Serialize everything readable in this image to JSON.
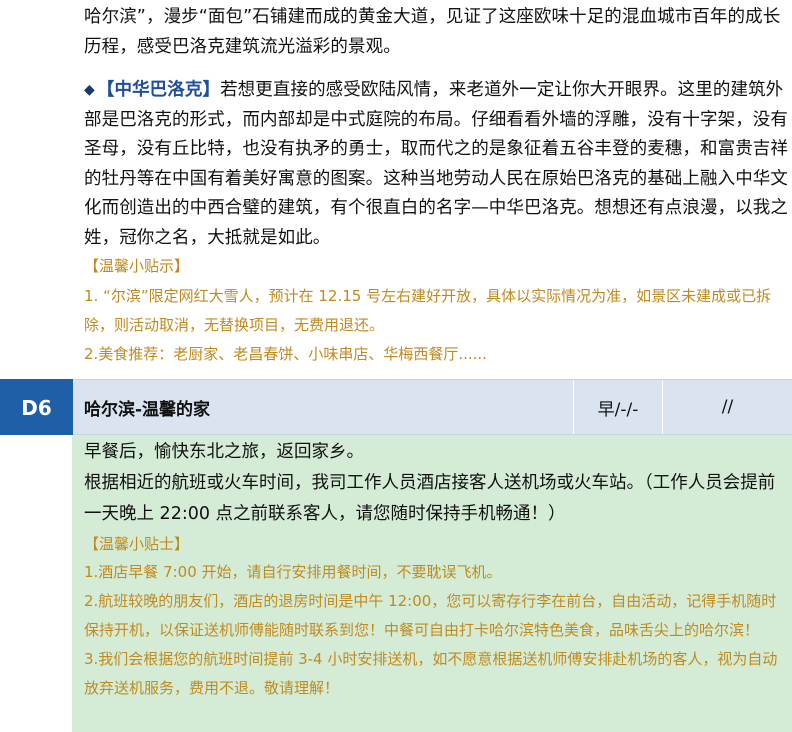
{
  "intro": {
    "text": "哈尔滨”，漫步“面包”石铺建而成的黄金大道，见证了这座欧味十足的混血城市百年的成长历程，感受巴洛克建筑流光溢彩的景观。"
  },
  "highlight": {
    "bullet": "◆",
    "title": "【中华巴洛克】",
    "text": "若想更直接的感受欧陆风情，来老道外一定让你大开眼界。这里的建筑外部是巴洛克的形式，而内部却是中式庭院的布局。仔细看看外墙的浮雕，没有十字架，没有圣母，没有丘比特，也没有执矛的勇士，取而代之的是象征着五谷丰登的麦穗，和富贵吉祥的牡丹等在中国有着美好寓意的图案。这种当地劳动人民在原始巴洛克的基础上融入中华文化而创造出的中西合璧的建筑，有个很直白的名字—中华巴洛克。想想还有点浪漫，以我之姓，冠你之名，大抵就是如此。"
  },
  "tips_top": {
    "title": "【温馨小贴示】",
    "items": [
      "1. “尔滨”限定网红大雪人，预计在 12.15 号左右建好开放，具体以实际情况为准，如景区未建成或已拆除，则活动取消，无替换项目，无费用退还。",
      "2.美食推荐：老厨家、老昌春饼、小味串店、华梅西餐厅......"
    ]
  },
  "day": {
    "badge": "D6",
    "title": "哈尔滨-温馨的家",
    "meals": "早/-/-",
    "hotel": "//"
  },
  "day_body": {
    "lines": [
      "早餐后，愉快东北之旅，返回家乡。",
      "根据相近的航班或火车时间，我司工作人员酒店接客人送机场或火车站。（工作人员会提前一天晚上 22:00 点之前联系客人，请您随时保持手机畅通！）"
    ],
    "tips_title": "【温馨小贴士】",
    "tips": [
      "1.酒店早餐 7:00 开始，请自行安排用餐时间，不要耽误飞机。",
      "2.航班较晚的朋友们，酒店的退房时间是中午 12:00，您可以寄存行李在前台，自由活动，记得手机随时保持开机，以保证送机师傅能随时联系到您！中餐可自由打卡哈尔滨特色美食，品味舌尖上的哈尔滨！",
      "3.我们会根据您的航班时间提前 3-4 小时安排送机，如不愿意根据送机师傅安排赴机场的客人，视为自动放弃送机服务，费用不退。敬请理解！"
    ]
  }
}
